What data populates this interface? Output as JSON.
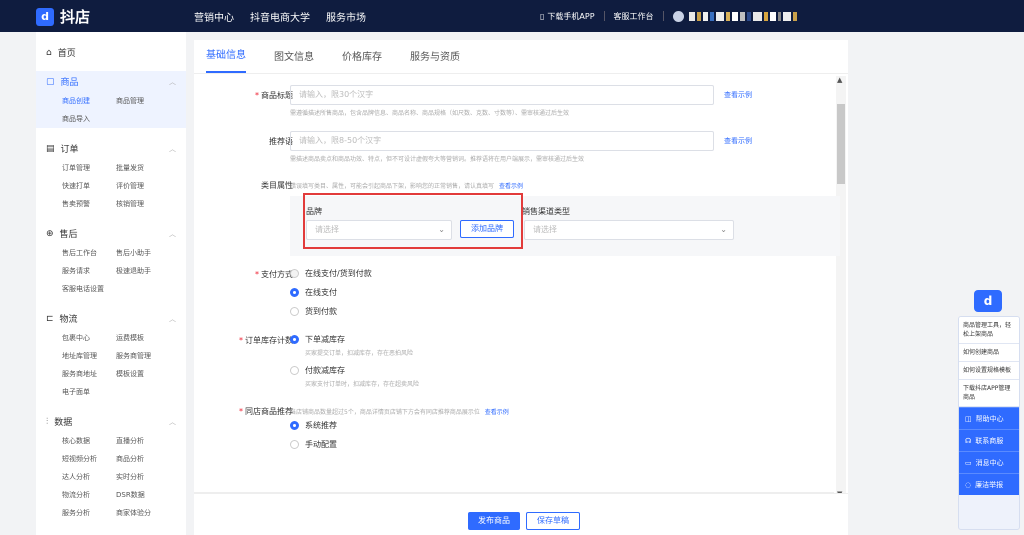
{
  "app": {
    "logo_mark": "d",
    "logo_text": "抖店"
  },
  "topnav": [
    "营销中心",
    "抖音电商大学",
    "服务市场"
  ],
  "topright": {
    "download": "下载手机APP",
    "workspace": "客服工作台"
  },
  "colors": {
    "accent": "#2f6bff",
    "topbar": "#0f1c3f",
    "highlight": "#e23b3b"
  },
  "sidebar": {
    "home": "首页",
    "groups": [
      {
        "title": "商品",
        "active": true,
        "items": [
          "商品创建",
          "商品管理",
          "商品导入"
        ]
      },
      {
        "title": "订单",
        "items": [
          "订单管理",
          "批量发货",
          "快速打单",
          "评价管理",
          "售卖预警",
          "核销管理"
        ]
      },
      {
        "title": "售后",
        "items": [
          "售后工作台",
          "售后小助手",
          "服务请求",
          "极速退助手",
          "客服电话设置"
        ]
      },
      {
        "title": "物流",
        "items": [
          "包裹中心",
          "运费模板",
          "地址库管理",
          "服务商管理",
          "服务商地址",
          "模板设置",
          "电子面单"
        ]
      },
      {
        "title": "数据",
        "items": [
          "核心数据",
          "直播分析",
          "短视频分析",
          "商品分析",
          "达人分析",
          "实时分析",
          "物流分析",
          "DSR数据",
          "服务分析",
          "商家体验分"
        ]
      }
    ]
  },
  "tabs": [
    "基础信息",
    "图文信息",
    "价格库存",
    "服务与资质"
  ],
  "form": {
    "title_label": "商品标题",
    "title_placeholder": "请输入，限30个汉字",
    "title_hint": "需遵循描述所售商品，包含品牌信息、商品名称、商品规格（如尺数、克数、寸数等）、需审核通过后生效",
    "example": "查看示例",
    "rec_label": "推荐语",
    "rec_placeholder": "请输入，限8-50个汉字",
    "rec_hint": "需描述商品卖点和商品功效、特点，但不可设计虚假夸大等营销词。推荐语将在用户端展示，需审核通过后生效",
    "attr_label": "类目属性",
    "attr_hint": "错误填写类目、属性，可能会引起商品下架，影响您的正常销售，请认真填写",
    "attr_example": "查看示例",
    "brand_label": "品牌",
    "brand_placeholder": "请选择",
    "add_brand": "添加品牌",
    "channel_label": "销售渠道类型",
    "channel_placeholder": "请选择",
    "pay_label": "支付方式",
    "pay_options": [
      "在线支付/货到付款",
      "在线支付",
      "货到付款"
    ],
    "stock_label": "订单库存计数",
    "stock_options": [
      "下单减库存",
      "付款减库存"
    ],
    "stock_subs": [
      "买家提交订单，扣减库存，存在恶拍风险",
      "买家支付订单时，扣减库存，存在超卖风险"
    ],
    "rec_goods_label": "同店商品推荐",
    "rec_goods_hint": "当店铺商品数量超过5个，商品详情页店铺下方会有同店推荐商品展示位",
    "rec_goods_example": "查看示例",
    "rec_goods_options": [
      "系统推荐",
      "手动配置"
    ]
  },
  "footer": {
    "publish": "发布商品",
    "save_draft": "保存草稿"
  },
  "helper": {
    "logo": "d",
    "items": [
      "商品管理工具，轻松上架商品",
      "如何创建商品",
      "如何设置规格模板",
      "下载抖店APP管理商品"
    ],
    "actions": [
      "帮助中心",
      "联系商服",
      "消息中心",
      "廉洁举报"
    ]
  }
}
